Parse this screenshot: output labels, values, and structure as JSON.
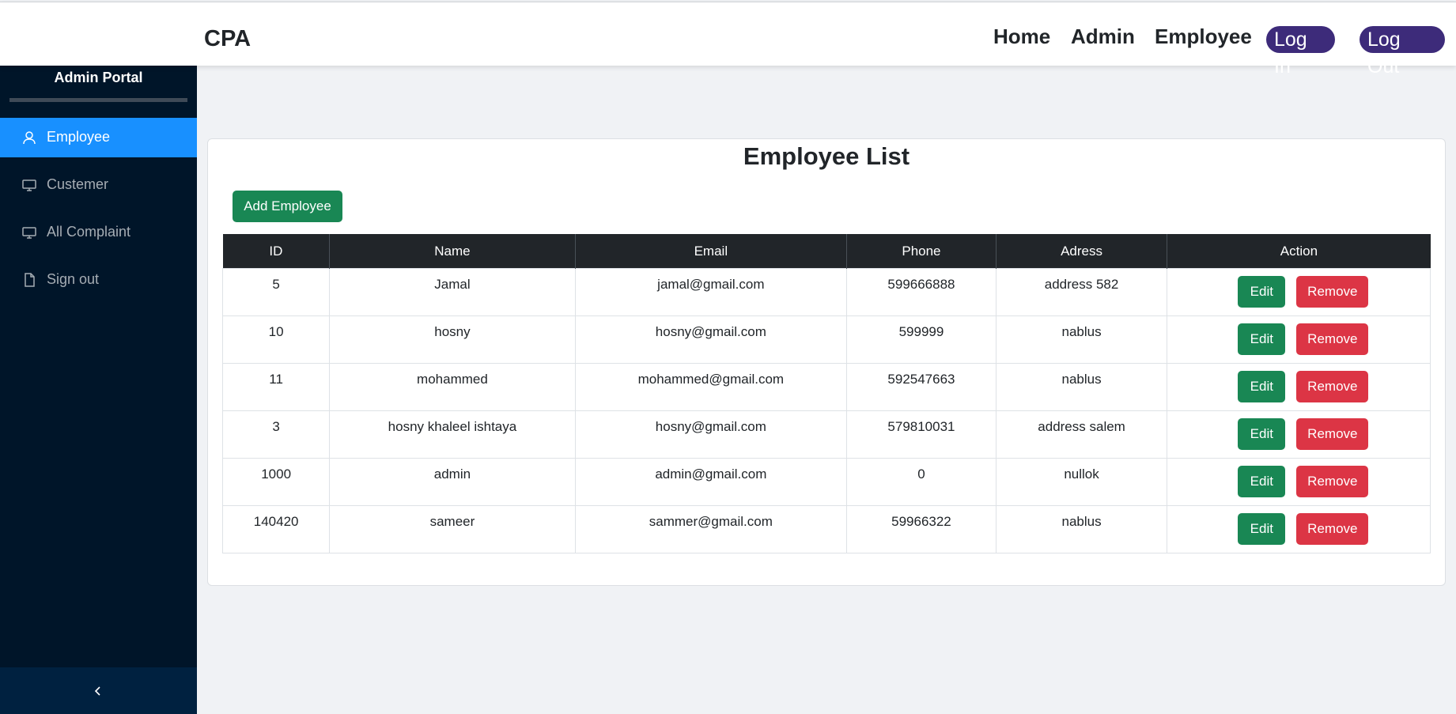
{
  "navbar": {
    "brand": "CPA",
    "links": [
      "Home",
      "Admin",
      "Employee"
    ],
    "login": "Log In",
    "logout": "Log Out"
  },
  "sidebar": {
    "title": "Admin Portal",
    "items": [
      {
        "label": "Employee",
        "icon": "user-icon",
        "active": true
      },
      {
        "label": "Custemer",
        "icon": "desktop-icon",
        "active": false
      },
      {
        "label": "All Complaint",
        "icon": "desktop-icon",
        "active": false
      },
      {
        "label": "Sign out",
        "icon": "file-icon",
        "active": false
      }
    ],
    "collapse_icon": "chevron-left-icon"
  },
  "main": {
    "title": "Employee List",
    "add_button": "Add Employee",
    "table": {
      "headers": [
        "ID",
        "Name",
        "Email",
        "Phone",
        "Adress",
        "Action"
      ],
      "rows": [
        {
          "id": "5",
          "name": "Jamal",
          "email": "jamal@gmail.com",
          "phone": "599666888",
          "address": "address 582"
        },
        {
          "id": "10",
          "name": "hosny",
          "email": "hosny@gmail.com",
          "phone": "599999",
          "address": "nablus"
        },
        {
          "id": "11",
          "name": "mohammed",
          "email": "mohammed@gmail.com",
          "phone": "592547663",
          "address": "nablus"
        },
        {
          "id": "3",
          "name": "hosny khaleel ishtaya",
          "email": "hosny@gmail.com",
          "phone": "579810031",
          "address": "address salem"
        },
        {
          "id": "1000",
          "name": "admin",
          "email": "admin@gmail.com",
          "phone": "0",
          "address": "nullok"
        },
        {
          "id": "140420",
          "name": "sameer",
          "email": "sammer@gmail.com",
          "phone": "59966322",
          "address": "nablus"
        }
      ],
      "edit_label": "Edit",
      "remove_label": "Remove"
    }
  },
  "colors": {
    "sidebar_bg": "#001529",
    "sidebar_active": "#1890ff",
    "pill": "#3d2b7a",
    "success": "#198754",
    "danger": "#dc3545",
    "table_header": "#212529"
  }
}
